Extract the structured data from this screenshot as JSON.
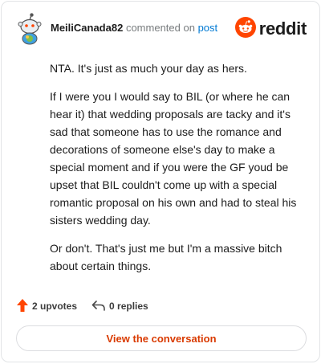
{
  "header": {
    "username": "MeiliCanada82",
    "commented_text": "commented on",
    "post_link": "post",
    "brand": "reddit"
  },
  "comment": {
    "paragraphs": [
      "NTA. It's just as much your day as hers.",
      "If I were you I would say to BIL (or where he can hear it) that wedding proposals are tacky and it's sad that someone has to use the romance and decorations of someone else's day to make a special moment and if you were the GF youd be upset that BIL couldn't come up with a special romantic proposal on his own and had to steal his sisters wedding day.",
      "Or don't. That's just me but I'm a massive bitch about certain things."
    ]
  },
  "actions": {
    "upvotes": "2 upvotes",
    "replies": "0 replies"
  },
  "cta": {
    "label": "View the conversation"
  },
  "colors": {
    "accent": "#ff4500",
    "link": "#0079d3",
    "cta_text": "#d93a00"
  },
  "icons": {
    "avatar": "snoo-avatar-icon",
    "brand": "reddit-logo-icon",
    "upvote": "upvote-arrow-icon",
    "reply": "reply-arrow-icon"
  }
}
